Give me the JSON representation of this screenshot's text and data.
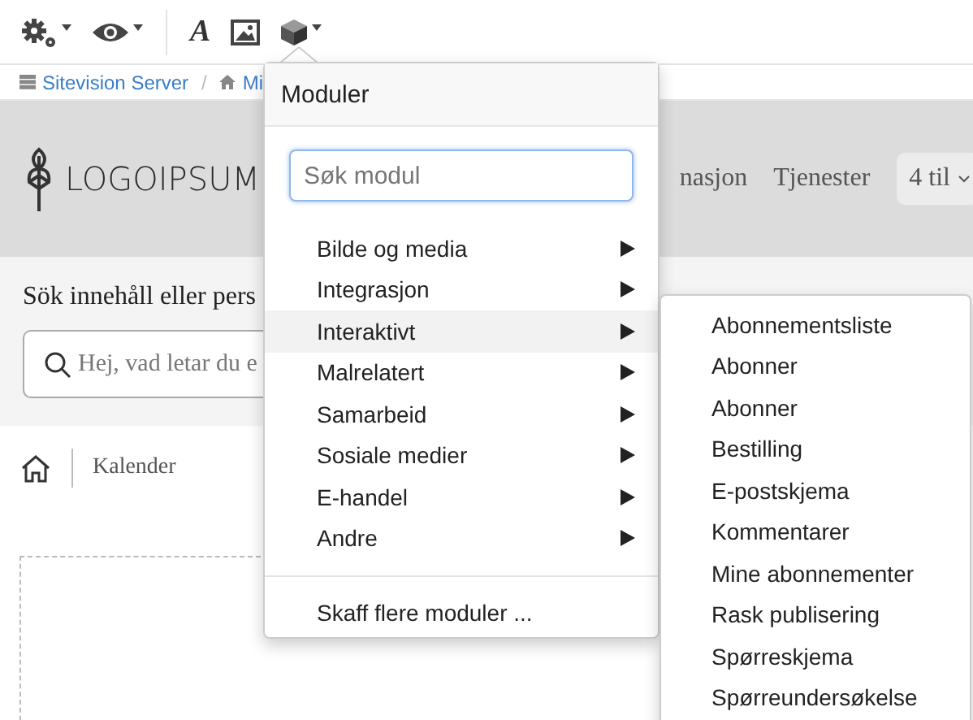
{
  "toolbar": {
    "buttons": [
      {
        "kind": "gear",
        "caret": true
      },
      {
        "kind": "eye",
        "caret": true
      },
      {
        "kind": "text",
        "label": "A",
        "caret": false
      },
      {
        "kind": "image",
        "caret": false
      },
      {
        "kind": "cube",
        "caret": true
      }
    ]
  },
  "breadcrumb": {
    "separator": "/",
    "items": [
      {
        "kind": "server",
        "label": "Sitevision Server"
      },
      {
        "kind": "home",
        "label": "Mi"
      }
    ]
  },
  "header": {
    "logo": "LOGOIPSUM",
    "nav": [
      "nasjon",
      "Tjenester"
    ],
    "select": "4 til"
  },
  "search": {
    "label": "Sök innehåll eller pers",
    "placeholder": "Hej, vad letar du e"
  },
  "page_breadcrumb": {
    "label": "Kalender"
  },
  "menu": {
    "title": "Moduler",
    "search": {
      "placeholder": "Søk modul"
    },
    "items": [
      {
        "label": "Bilde og media",
        "selected": false
      },
      {
        "label": "Integrasjon",
        "selected": false
      },
      {
        "label": "Interaktivt",
        "selected": true
      },
      {
        "label": "Malrelatert",
        "selected": false
      },
      {
        "label": "Samarbeid",
        "selected": false
      },
      {
        "label": "Sosiale medier",
        "selected": false
      },
      {
        "label": "E-handel",
        "selected": false
      },
      {
        "label": "Andre",
        "selected": false
      }
    ],
    "footer": "Skaff flere moduler ..."
  },
  "submenu": {
    "items": [
      "Abonnementsliste",
      "Abonner",
      "Abonner",
      "Bestilling",
      "E-postskjema",
      "Kommentarer",
      "Mine abonnementer",
      "Rask publisering",
      "Spørreskjema",
      "Spørreundersøkelse"
    ]
  }
}
